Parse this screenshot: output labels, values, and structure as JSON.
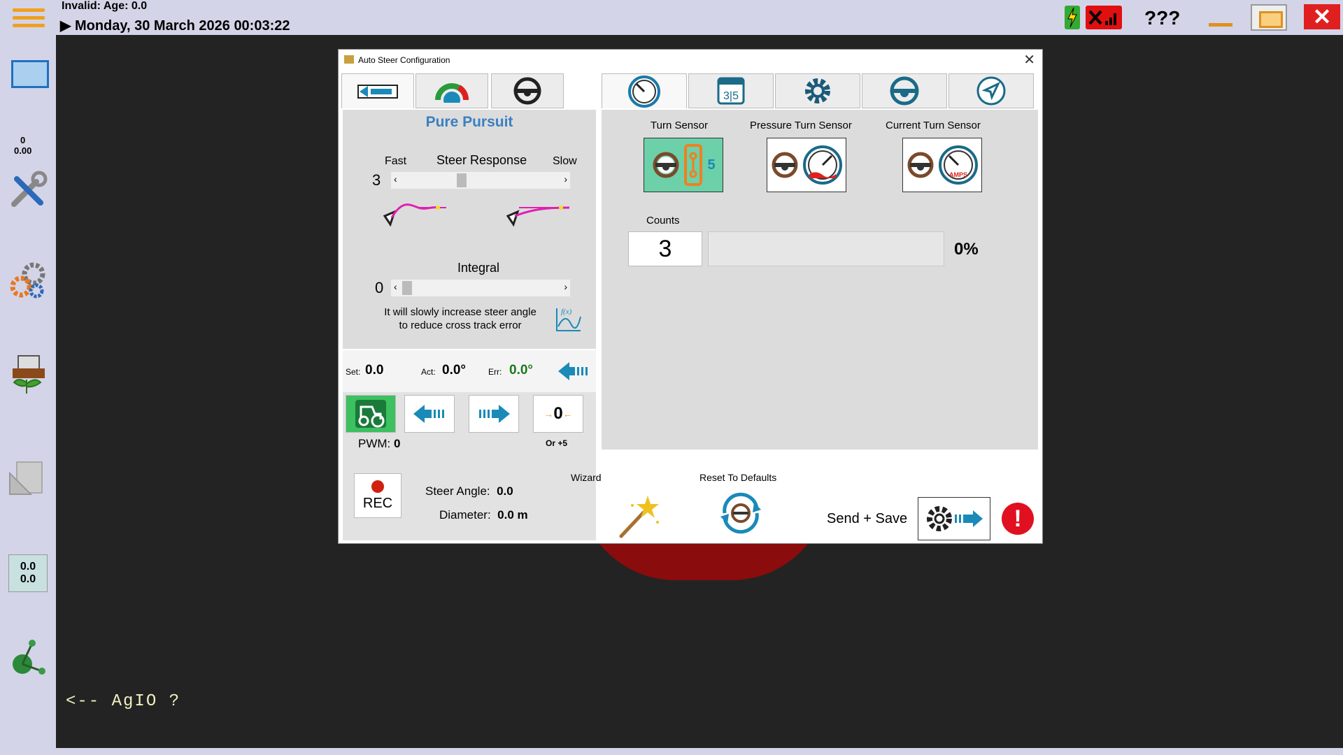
{
  "topbar": {
    "status": "Invalid: Age: 0.0",
    "datetime": "Monday, 30 March 2026 00:03:22",
    "unknown": "???"
  },
  "sidebar": {
    "num_top": "0",
    "num_bottom": "0.00",
    "coord_a": "0.0",
    "coord_b": "0.0"
  },
  "console": {
    "agio_text": "<-- AgIO ?"
  },
  "dialog": {
    "title": "Auto Steer Configuration",
    "close": "✕",
    "pure_pursuit": {
      "title": "Pure Pursuit",
      "fast": "Fast",
      "steer_response": "Steer Response",
      "slow": "Slow",
      "steer_response_value": "3",
      "steer_response_level": 0.35,
      "integral": "Integral",
      "integral_value": "0",
      "integral_level": 0.0,
      "integral_help": "It will slowly increase steer angle to reduce cross track error"
    },
    "angles": {
      "set_label": "Set:",
      "set_value": "0.0",
      "act_label": "Act:",
      "act_value": "0.0°",
      "err_label": "Err:",
      "err_value": "0.0°"
    },
    "controls": {
      "pwm_label": "PWM:",
      "pwm_value": "0",
      "zero_value": "0",
      "or_plus5": "Or +5",
      "rec_label": "REC",
      "steer_angle_label": "Steer Angle:",
      "steer_angle_value": "0.0",
      "diameter_label": "Diameter:",
      "diameter_value": "0.0 m"
    },
    "sensors": {
      "turn_sensor": "Turn Sensor",
      "pressure_turn_sensor": "Pressure Turn Sensor",
      "current_turn_sensor": "Current Turn Sensor",
      "turn_badge": "5",
      "amps_label": "AMPS",
      "counts_label": "Counts",
      "counts_value": "3",
      "percent_text": "0%",
      "percent_level": 0
    },
    "bottom": {
      "wizard": "Wizard",
      "reset_defaults": "Reset To Defaults",
      "send_save": "Send + Save"
    }
  },
  "colors": {
    "accent_blue": "#1a8ab8",
    "active_green": "#6cd0a8",
    "warning_red": "#e01020",
    "orange": "#f0a020"
  }
}
